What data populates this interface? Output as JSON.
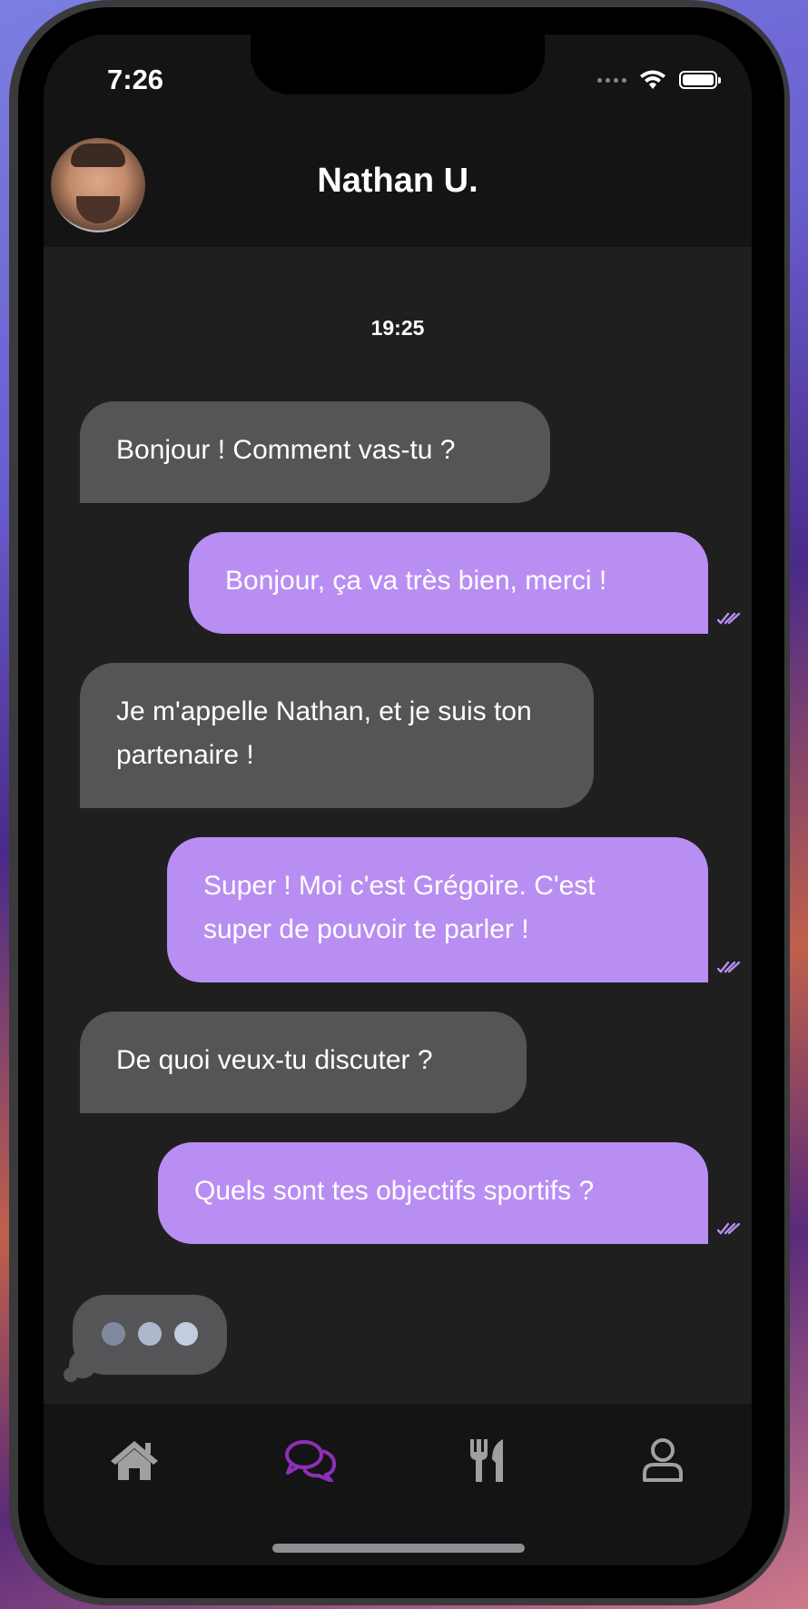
{
  "status_bar": {
    "time": "7:26"
  },
  "header": {
    "contact_name": "Nathan U."
  },
  "chat": {
    "time_label": "19:25",
    "messages": [
      {
        "sender": "partner",
        "text": "Bonjour ! Comment vas-tu ?"
      },
      {
        "sender": "me",
        "text": "Bonjour, ça va très bien, merci !",
        "read": true
      },
      {
        "sender": "partner",
        "text": "Je m'appelle Nathan, et je suis ton partenaire !"
      },
      {
        "sender": "me",
        "text": "Super ! Moi c'est Grégoire. C'est super de pouvoir te parler !",
        "read": true
      },
      {
        "sender": "partner",
        "text": "De quoi veux-tu discuter ?"
      },
      {
        "sender": "me",
        "text": "Quels sont tes objectifs sportifs ?",
        "read": true
      }
    ],
    "typing_indicator": true
  },
  "tabbar": {
    "items": [
      {
        "icon": "home-icon",
        "active": false
      },
      {
        "icon": "chat-icon",
        "active": true
      },
      {
        "icon": "utensils-icon",
        "active": false
      },
      {
        "icon": "user-icon",
        "active": false
      }
    ],
    "active_color": "#8e2fb8",
    "inactive_color": "#a0a0a0"
  },
  "colors": {
    "incoming_bubble": "#555557",
    "outgoing_bubble": "#b98ef2",
    "background": "#1f1f20"
  }
}
